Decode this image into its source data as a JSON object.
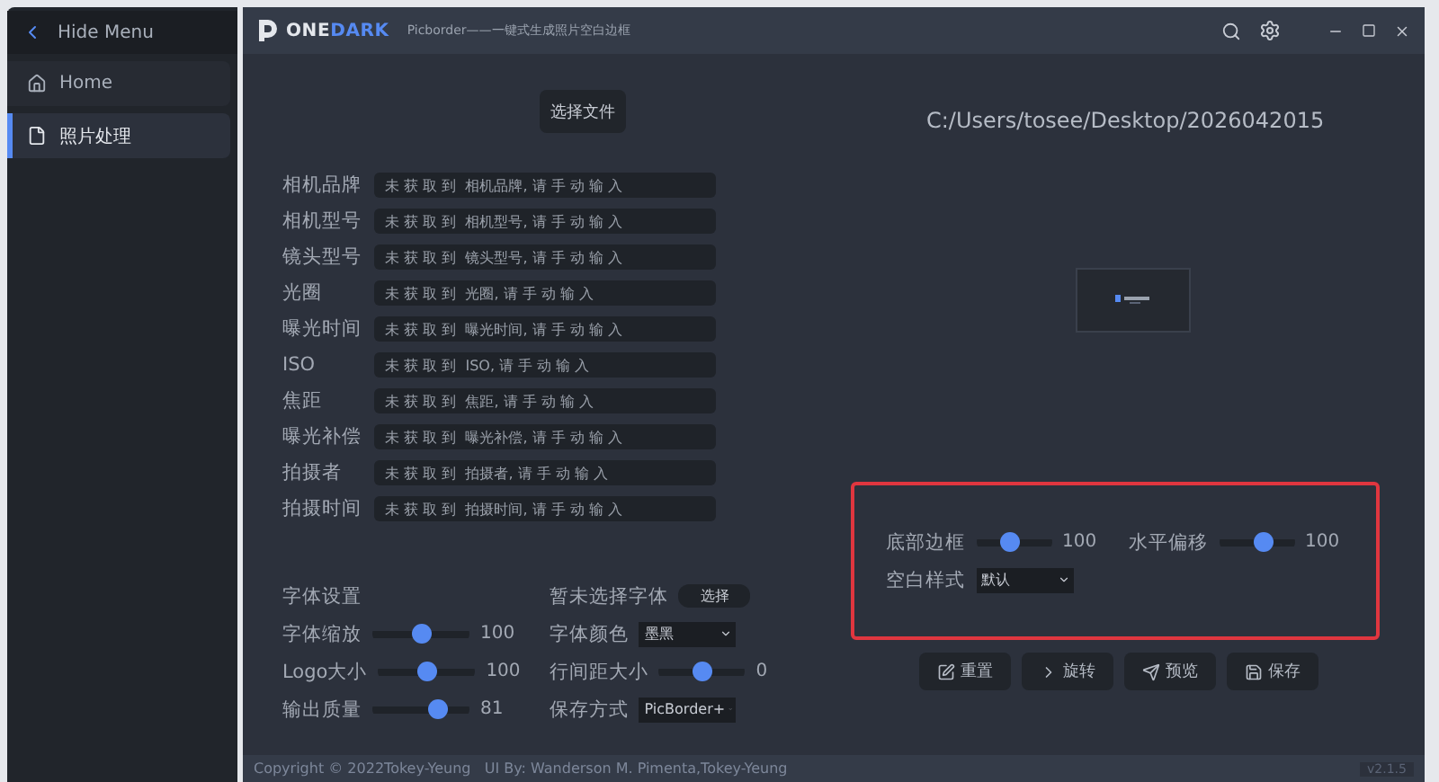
{
  "sidebar": {
    "toggle": "Hide Menu",
    "items": [
      {
        "label": "Home",
        "kind": "home",
        "selected": false
      },
      {
        "label": "照片处理",
        "kind": "file",
        "selected": true
      }
    ]
  },
  "title_bar": {
    "logo_first": "ONE",
    "logo_second": "DARK",
    "subtitle": "Picborder——一键式生成照片空白边框"
  },
  "file_button": "选择文件",
  "file_path": "C:/Users/tosee/Desktop/2026042015",
  "fields": [
    {
      "label": "相机品牌",
      "placeholder": "未 获 取 到  相机品牌, 请 手 动 输 入"
    },
    {
      "label": "相机型号",
      "placeholder": "未 获 取 到  相机型号, 请 手 动 输 入"
    },
    {
      "label": "镜头型号",
      "placeholder": "未 获 取 到  镜头型号, 请 手 动 输 入"
    },
    {
      "label": "光圈",
      "placeholder": "未 获 取 到  光圈, 请 手 动 输 入"
    },
    {
      "label": "曝光时间",
      "placeholder": "未 获 取 到  曝光时间, 请 手 动 输 入"
    },
    {
      "label": "ISO",
      "placeholder": "未 获 取 到  ISO, 请 手 动 输 入"
    },
    {
      "label": "焦距",
      "placeholder": "未 获 取 到  焦距, 请 手 动 输 入"
    },
    {
      "label": "曝光补偿",
      "placeholder": "未 获 取 到  曝光补偿, 请 手 动 输 入"
    },
    {
      "label": "拍摄者",
      "placeholder": "未 获 取 到  拍摄者, 请 手 动 输 入"
    },
    {
      "label": "拍摄时间",
      "placeholder": "未 获 取 到  拍摄时间, 请 手 动 输 入"
    }
  ],
  "settings_left": [
    {
      "kind": "heading",
      "label": "字体设置"
    },
    {
      "kind": "slider",
      "label": "字体缩放",
      "level": 0.5,
      "reading": "100"
    },
    {
      "kind": "slider",
      "label": "Logo大小",
      "level": 0.5,
      "reading": "100"
    },
    {
      "kind": "slider",
      "label": "输出质量",
      "level": 0.72,
      "reading": "81"
    }
  ],
  "settings_right": [
    {
      "kind": "button",
      "label": "暂未选择字体",
      "value": "选择"
    },
    {
      "kind": "dropdown",
      "label": "字体颜色",
      "value": "墨黑"
    },
    {
      "kind": "slider",
      "label": "行间距大小",
      "level": 0.5,
      "reading": "0"
    },
    {
      "kind": "dropdown",
      "label": "保存方式",
      "value": "PicBorder+"
    }
  ],
  "border_panel": [
    {
      "kind": "slider",
      "label": "底部边框",
      "level": 0.45,
      "reading": "100"
    },
    {
      "kind": "slider",
      "label": "水平偏移",
      "level": 0.62,
      "reading": "100"
    },
    {
      "kind": "dropdown",
      "label": "空白样式",
      "value": "默认"
    }
  ],
  "actions": [
    {
      "label": "重置",
      "kind": "edit"
    },
    {
      "label": "旋转",
      "kind": "chevron"
    },
    {
      "label": "预览",
      "kind": "send"
    },
    {
      "label": "保存",
      "kind": "save"
    }
  ],
  "footer": {
    "copyright": "Copyright © 2022Tokey-Yeung   UI By: Wanderson M. Pimenta,Tokey-Yeung",
    "version": "v2.1.5"
  }
}
